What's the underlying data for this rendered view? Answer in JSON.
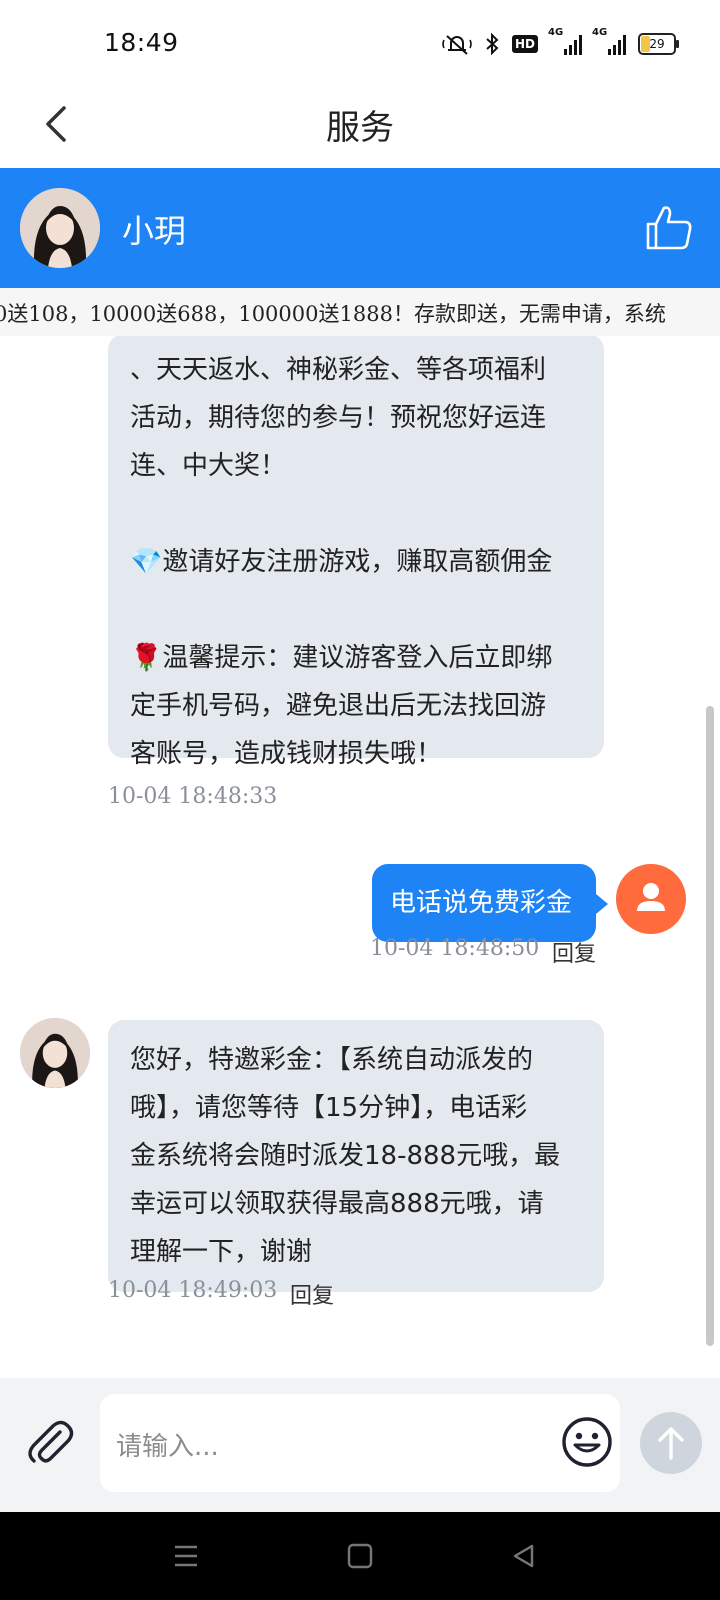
{
  "status_bar": {
    "time": "18:49",
    "network_1": "4G",
    "network_2": "4G",
    "hd_label": "HD",
    "battery": "29",
    "icons": [
      "mute-icon",
      "bluetooth-icon",
      "hd-icon",
      "signal-icon",
      "signal-icon",
      "battery-icon"
    ]
  },
  "nav": {
    "title": "服务",
    "back_icon": "chevron-left-icon"
  },
  "agent": {
    "name": "小玥",
    "like_icon": "thumbs-up-icon",
    "brand_color": "#1e83f5"
  },
  "marquee": {
    "text": "0送108，10000送688，100000送1888！存款即送，无需申请，系统"
  },
  "messages": [
    {
      "from": "agent",
      "lines": [
        "、天天返水、神秘彩金、等各项福利",
        "活动，期待您的参与！预祝您好运连",
        "连、中大奖！",
        "",
        "💎邀请好友注册游戏，赚取高额佣金",
        "",
        "🌹温馨提示：建议游客登入后立即绑",
        "定手机号码，避免退出后无法找回游",
        "客账号，造成钱财损失哦！"
      ],
      "time": "10-04 18:48:33"
    },
    {
      "from": "user",
      "text": "电话说免费彩金",
      "time": "10-04 18:48:50",
      "reply": "回复"
    },
    {
      "from": "agent",
      "lines": [
        "您好，特邀彩金：【系统自动派发的",
        "哦】，请您等待【15分钟】，电话彩",
        "金系统将会随时派发18-888元哦，最",
        "幸运可以领取获得最高888元哦，请",
        "理解一下，谢谢"
      ],
      "time": "10-04 18:49:03",
      "reply": "回复"
    }
  ],
  "input": {
    "placeholder": "请输入...",
    "attach_icon": "paperclip-icon",
    "emoji_icon": "smiley-icon",
    "send_icon": "arrow-up-icon"
  },
  "system_nav": [
    "menu-icon",
    "home-icon",
    "back-icon"
  ]
}
